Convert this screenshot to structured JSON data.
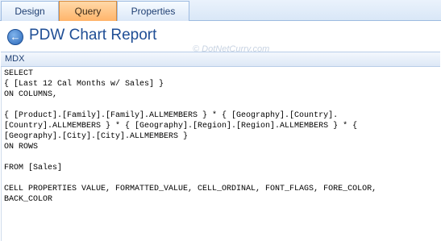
{
  "tabs": {
    "design": "Design",
    "query": "Query",
    "properties": "Properties",
    "active": "Query"
  },
  "header": {
    "back_icon": "back-arrow-icon",
    "title": "PDW Chart Report"
  },
  "section": {
    "label": "MDX"
  },
  "watermark": "© DotNetCurry.com",
  "editor": {
    "lines": [
      "SELECT",
      "{ [Last 12 Cal Months w/ Sales] }",
      "ON COLUMNS,",
      "",
      "{ [Product].[Family].[Family].ALLMEMBERS } * { [Geography].[Country].",
      "[Country].ALLMEMBERS } * { [Geography].[Region].[Region].ALLMEMBERS } * {",
      "[Geography].[City].[City].ALLMEMBERS }",
      "ON ROWS",
      "",
      "FROM [Sales]",
      "",
      "CELL PROPERTIES VALUE, FORMATTED_VALUE, CELL_ORDINAL, FONT_FLAGS, FORE_COLOR,",
      "BACK_COLOR"
    ]
  },
  "colors": {
    "active_tab": "#ffb46a",
    "title": "#1f4e95",
    "tab_border": "#9ebbe0"
  }
}
